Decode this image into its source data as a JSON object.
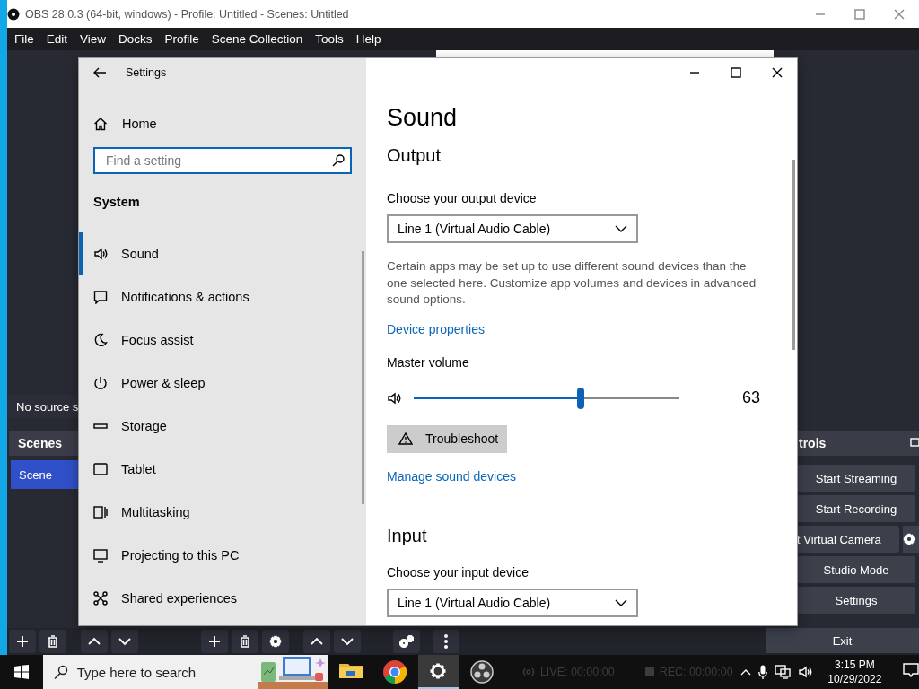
{
  "obs_window": {
    "title": "OBS 28.0.3 (64-bit, windows) - Profile: Untitled - Scenes: Untitled",
    "menu": [
      "File",
      "Edit",
      "View",
      "Docks",
      "Profile",
      "Scene Collection",
      "Tools",
      "Help"
    ],
    "preview_status": "No source s",
    "scenes_dock": {
      "title": "Scenes",
      "items": [
        {
          "label": "Scene",
          "selected": true
        }
      ]
    },
    "controls_dock": {
      "title": "trols",
      "buttons": [
        {
          "label": "Start Streaming",
          "kind": "plain"
        },
        {
          "label": "Start Recording",
          "kind": "plain"
        },
        {
          "label": "t Virtual Camera",
          "kind": "with-gear"
        },
        {
          "label": "Studio Mode",
          "kind": "plain"
        },
        {
          "label": "Settings",
          "kind": "plain"
        }
      ]
    },
    "exit_button": "Exit",
    "status": [
      "LIVE: 00:00:00",
      "REC: 00:00:00"
    ]
  },
  "settings_window": {
    "title": "Settings",
    "home": "Home",
    "search": {
      "placeholder": "Find a setting"
    },
    "section": "System",
    "nav": [
      {
        "label": "Sound",
        "kind": "sound",
        "selected": true
      },
      {
        "label": "Notifications & actions",
        "kind": "notifications",
        "selected": false
      },
      {
        "label": "Focus assist",
        "kind": "moon",
        "selected": false
      },
      {
        "label": "Power & sleep",
        "kind": "power",
        "selected": false
      },
      {
        "label": "Storage",
        "kind": "storage",
        "selected": false
      },
      {
        "label": "Tablet",
        "kind": "tablet",
        "selected": false
      },
      {
        "label": "Multitasking",
        "kind": "multitask",
        "selected": false
      },
      {
        "label": "Projecting to this PC",
        "kind": "project",
        "selected": false
      },
      {
        "label": "Shared experiences",
        "kind": "share",
        "selected": false
      }
    ],
    "page_title": "Sound",
    "output": {
      "heading": "Output",
      "device_label": "Choose your output device",
      "device": "Line 1 (Virtual Audio Cable)",
      "note": "Certain apps may be set up to use different sound devices than the one selected here. Customize app volumes and devices in advanced sound options.",
      "properties_link": "Device properties",
      "volume_label": "Master volume",
      "volume": {
        "level": 0.63,
        "reading": "63"
      },
      "troubleshoot": "Troubleshoot",
      "manage_link": "Manage sound devices"
    },
    "input": {
      "heading": "Input",
      "device_label": "Choose your input device",
      "device": "Line 1 (Virtual Audio Cable)"
    }
  },
  "taskbar": {
    "search_placeholder": "Type here to search",
    "apps": [
      {
        "kind": "folder",
        "selected": false
      },
      {
        "kind": "browser",
        "selected": false
      },
      {
        "kind": "gear",
        "selected": true
      },
      {
        "kind": "obs",
        "selected": false
      }
    ],
    "time": "3:15 PM",
    "date": "10/29/2022"
  }
}
